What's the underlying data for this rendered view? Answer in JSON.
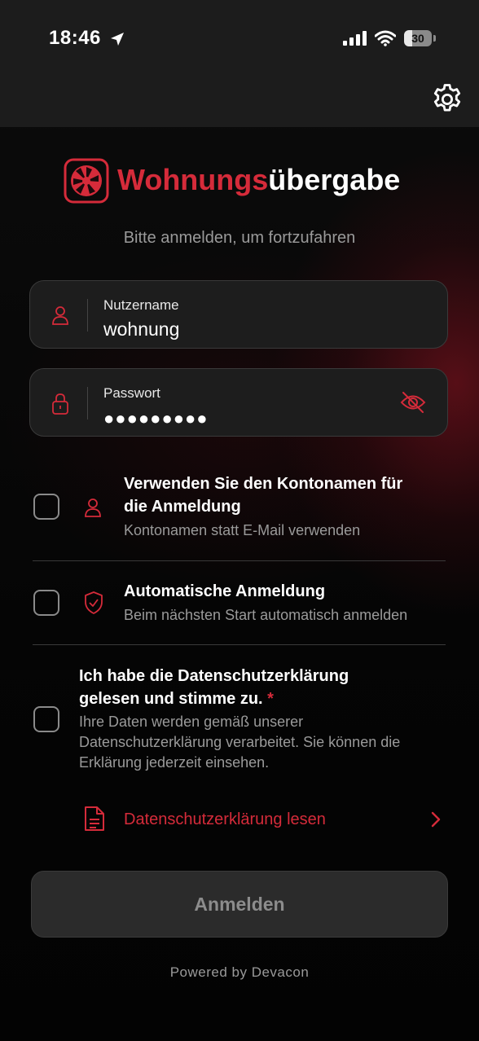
{
  "status_bar": {
    "time": "18:46",
    "battery": "30"
  },
  "header": {
    "settings_icon": "gear-icon"
  },
  "brand": {
    "title_part1": "Wohnungs",
    "title_part2": "übergabe",
    "accent_color": "#d52b3a"
  },
  "subtitle": "Bitte anmelden, um fortzufahren",
  "username": {
    "label": "Nutzername",
    "value": "wohnung"
  },
  "password": {
    "label": "Passwort",
    "value": "●●●●●●●●●"
  },
  "options": {
    "account_name": {
      "title_line1": "Verwenden Sie den Kontonamen für",
      "title_line2": "die Anmeldung",
      "subtitle": "Kontonamen statt E-Mail verwenden"
    },
    "auto_login": {
      "title": "Automatische Anmeldung",
      "subtitle": "Beim nächsten Start automatisch anmelden"
    },
    "privacy": {
      "title_line1": "Ich habe die Datenschutzerklärung",
      "title_line2": "gelesen und stimme zu.",
      "required_mark": "*",
      "subtitle_line1": "Ihre Daten werden gemäß unserer",
      "subtitle_line2": "Datenschutzerklärung verarbeitet. Sie können die",
      "subtitle_line3": "Erklärung jederzeit einsehen.",
      "link": "Datenschutzerklärung lesen"
    }
  },
  "login_button": "Anmelden",
  "footer": "Powered by Devacon"
}
